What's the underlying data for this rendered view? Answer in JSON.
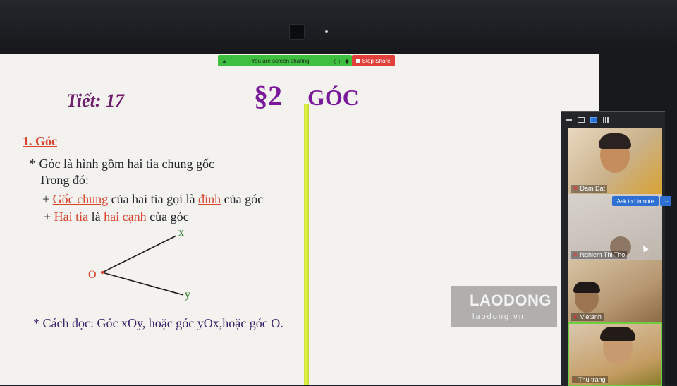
{
  "screen_share": {
    "status_text": "You are screen sharing",
    "stop_label": "Stop Share",
    "bar_color": "#3fbf3f",
    "stop_color": "#e2403a"
  },
  "slide": {
    "lesson": "Tiết: 17",
    "section": "§2",
    "title": "GÓC",
    "heading": "1. Góc",
    "definition": "* Góc là hình gồm hai tia chung gốc",
    "trong_do": "Trong đó:",
    "point1": {
      "prefix": "+ ",
      "term1": "Gốc chung",
      "mid": " của hai tia gọi là ",
      "term2": "đỉnh",
      "suffix": " của góc"
    },
    "point2": {
      "prefix": "+ ",
      "term1": "Hai tia",
      "mid": " là ",
      "term2": "hai cạnh",
      "suffix": " của góc"
    },
    "diagram": {
      "label_o": "O",
      "label_x": "x",
      "label_y": "y"
    },
    "reading": "* Cách đọc: Góc xOy, hoặc góc yOx,hoặc góc O."
  },
  "panel": {
    "participants": [
      {
        "name": "Dam Dat"
      },
      {
        "name": "Nghiem Thi Tho"
      },
      {
        "name": "Vietanh"
      },
      {
        "name": "Thu trang"
      }
    ],
    "ask_unmute": "Ask to Unmute",
    "more": "···",
    "accent": "#2d6fd3",
    "active_speaker_color": "#6ccf3b"
  },
  "watermark": {
    "brand": "LAODONG",
    "domain": "laodong.vn"
  }
}
